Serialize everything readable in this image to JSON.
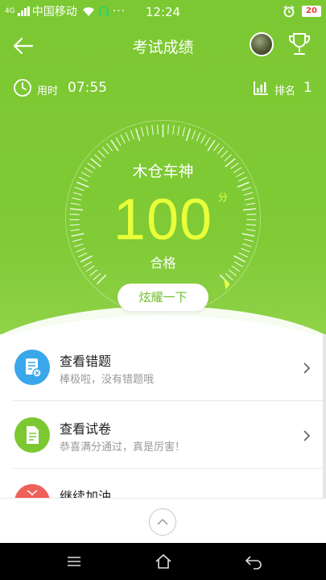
{
  "status_bar": {
    "network_type": "4G",
    "carrier": "中国移动",
    "time": "12:24",
    "battery": "20"
  },
  "header": {
    "title": "考试成绩"
  },
  "stats": {
    "time_label": "用时",
    "time_value": "07:55",
    "rank_label": "排名",
    "rank_value": "1"
  },
  "result": {
    "username": "木仓车神",
    "score": "100",
    "score_unit": "分",
    "status": "合格",
    "share_label": "炫耀一下"
  },
  "menu": {
    "items": [
      {
        "title": "查看错题",
        "subtitle": "棒极啦，没有错题哦",
        "icon": "wrong-answers-icon",
        "color": "#3aa7ea"
      },
      {
        "title": "查看试卷",
        "subtitle": "恭喜满分通过，真是厉害！",
        "icon": "exam-paper-icon",
        "color": "#7cc832"
      },
      {
        "title": "继续加油",
        "subtitle": "",
        "icon": "gift-icon",
        "color": "#f0605a"
      }
    ]
  },
  "colors": {
    "primary_green": "#7cc832",
    "score_yellow": "#e8ff3a"
  }
}
